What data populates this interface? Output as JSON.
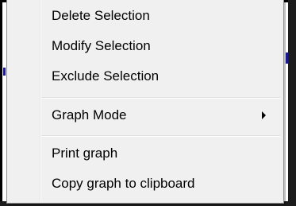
{
  "context_menu": {
    "items": [
      {
        "label": "Delete Selection"
      },
      {
        "label": "Modify Selection"
      },
      {
        "label": "Exclude Selection"
      },
      {
        "label": "Graph Mode",
        "has_submenu": true
      },
      {
        "label": "Print graph"
      },
      {
        "label": "Copy graph to clipboard"
      }
    ]
  },
  "icons": {
    "submenu_arrow": "chevron-right-icon"
  },
  "colors": {
    "menu_background": "#f0f0f0",
    "menu_border": "#8f8f8f",
    "text": "#000000",
    "window_frame": "#000000"
  }
}
